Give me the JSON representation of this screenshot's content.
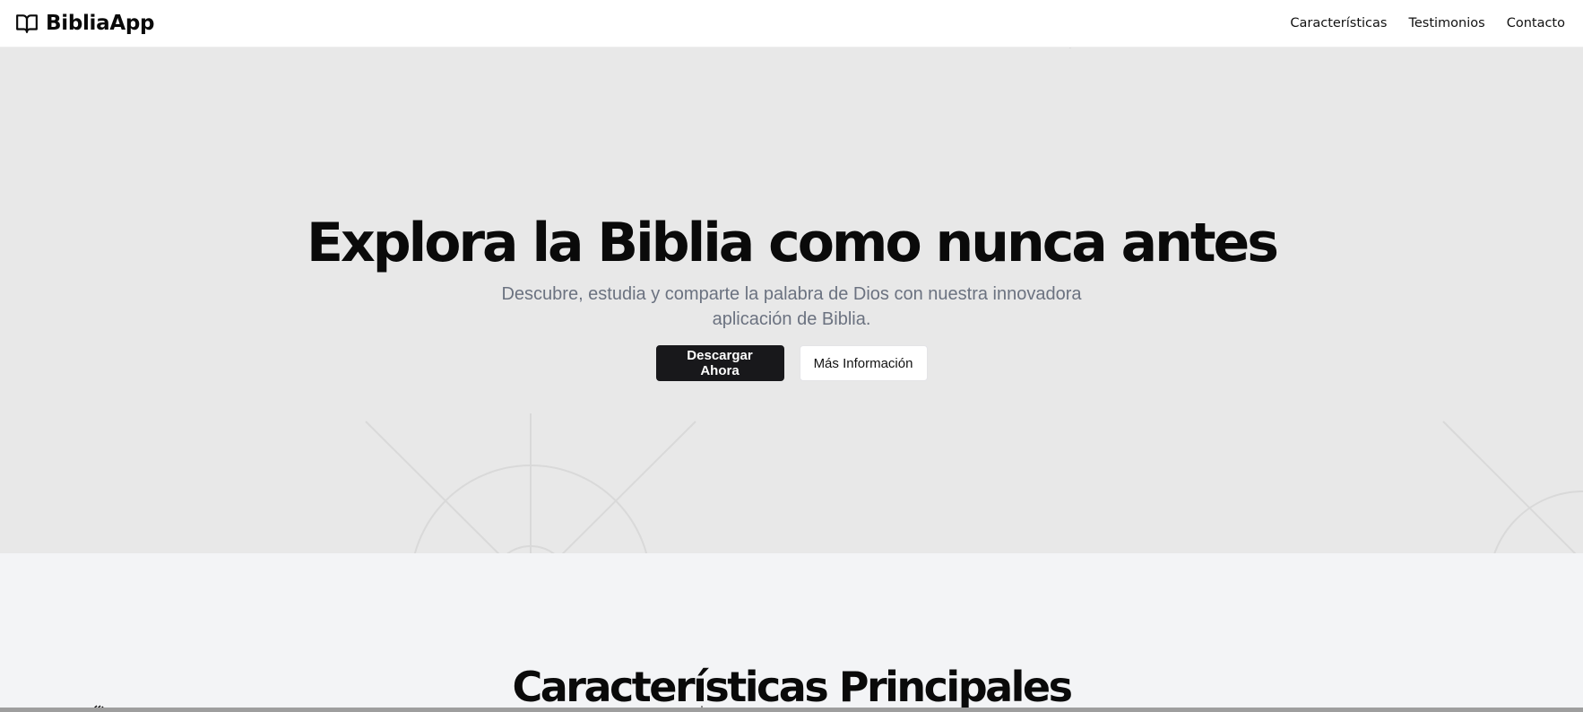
{
  "header": {
    "brand": {
      "icon": "open-book-icon",
      "name": "BibliaApp"
    },
    "nav": [
      {
        "label": "Características"
      },
      {
        "label": "Testimonios"
      },
      {
        "label": "Contacto"
      }
    ]
  },
  "hero": {
    "title": "Explora la Biblia como nunca antes",
    "subtitle": "Descubre, estudia y comparte la palabra de Dios con nuestra innovadora aplicación de Biblia.",
    "primary_button": "Descargar Ahora",
    "secondary_button": "Más Información",
    "colors": {
      "background": "#e8e8e8",
      "primary": "#18181b",
      "subtitle": "#6b7280"
    }
  },
  "features": {
    "title": "Características Principales",
    "colors": {
      "background": "#f3f4f6"
    }
  }
}
